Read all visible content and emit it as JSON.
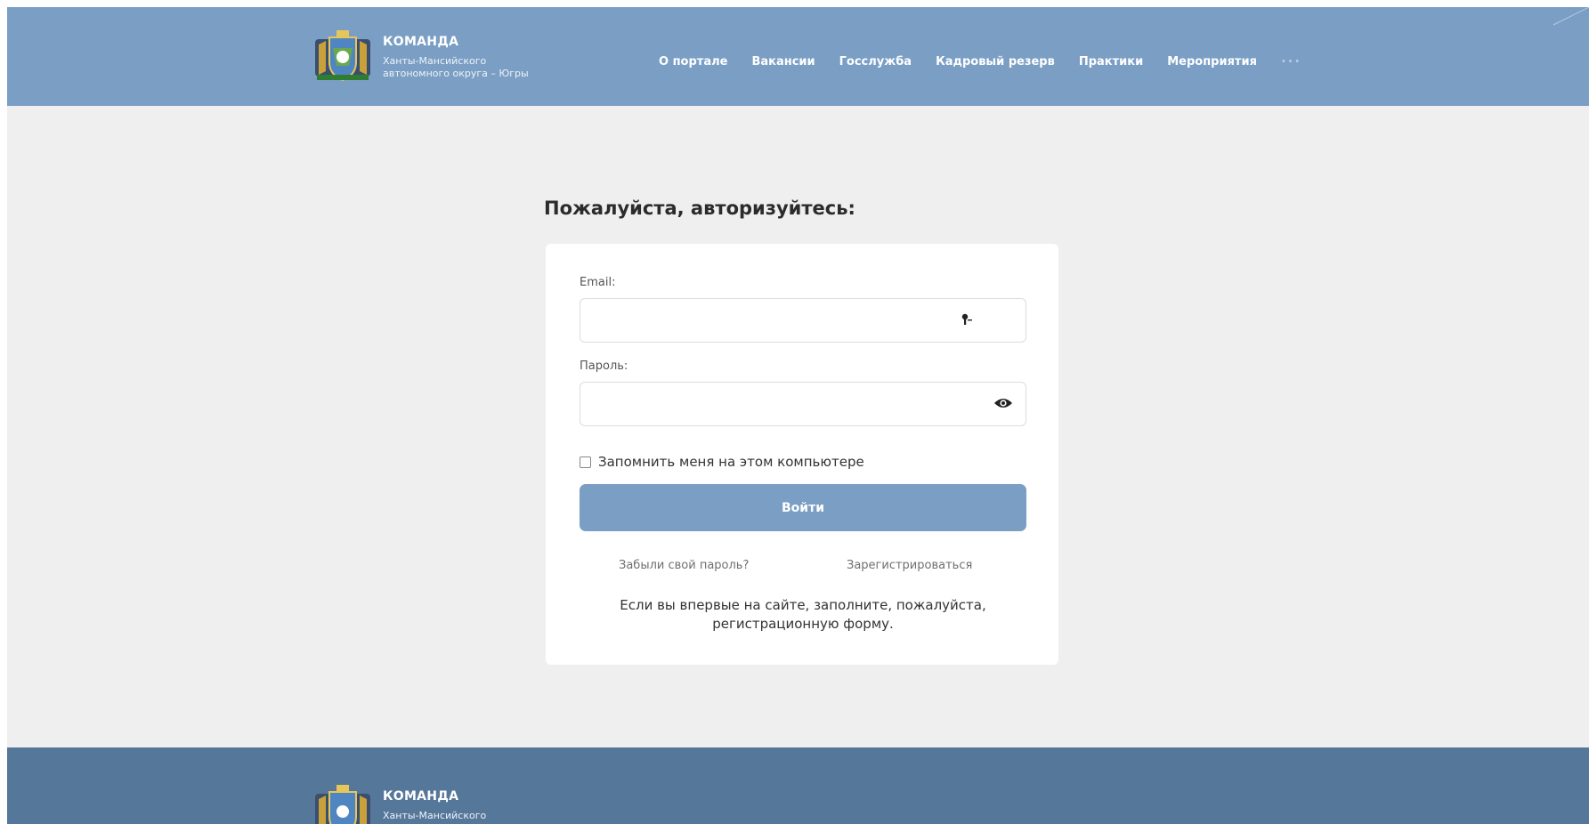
{
  "header": {
    "brand_title": "КОМАНДА",
    "brand_sub_line1": "Ханты-Мансийского",
    "brand_sub_line2": "автономного округа – Югры",
    "nav": [
      {
        "label": "О портале"
      },
      {
        "label": "Вакансии"
      },
      {
        "label": "Госслужба"
      },
      {
        "label": "Кадровый резерв"
      },
      {
        "label": "Практики"
      },
      {
        "label": "Мероприятия"
      }
    ],
    "more_label": "···"
  },
  "login": {
    "title": "Пожалуйста, авторизуйтесь:",
    "email_label": "Email:",
    "email_value": "",
    "password_label": "Пароль:",
    "password_value": "",
    "remember_label": "Запомнить меня на этом компьютере",
    "remember_checked": false,
    "submit_label": "Войти",
    "forgot_link": "Забыли свой пароль?",
    "register_link": "Зарегистрироваться",
    "note_line1": "Если вы впервые на сайте, заполните, пожалуйста,",
    "note_line2": "регистрационную форму."
  },
  "footer": {
    "brand_title": "КОМАНДА",
    "brand_sub_line1": "Ханты-Мансийского"
  },
  "colors": {
    "header_bg": "#7a9ec4",
    "footer_bg": "#557799",
    "button_bg": "#7a9ec4",
    "page_bg": "#efefef"
  },
  "icons": [
    "coat-of-arms-icon",
    "key-icon",
    "eye-icon",
    "checkbox-icon"
  ]
}
